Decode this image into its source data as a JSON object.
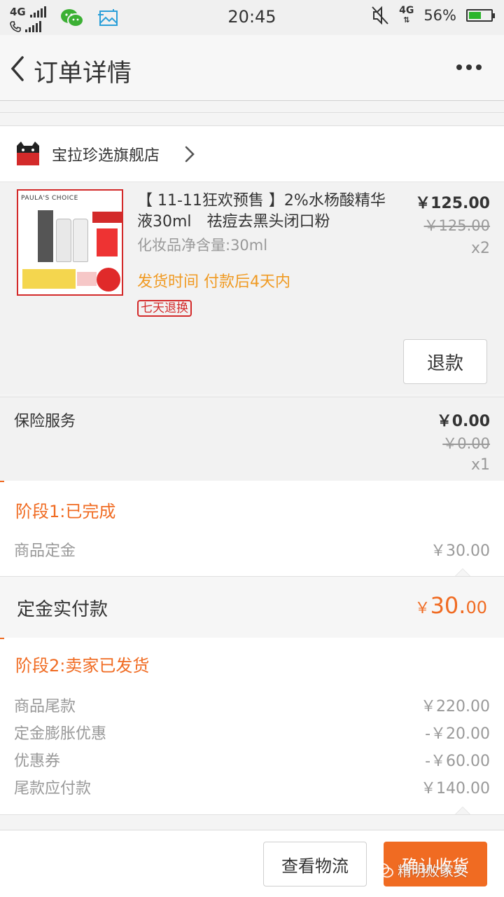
{
  "status_bar": {
    "network_top": "4G",
    "time": "20:45",
    "network_right": "4G",
    "battery_percent": "56%",
    "battery_level": 0.56,
    "battery_color": "#2bb52b"
  },
  "nav": {
    "title": "订单详情",
    "back_icon": "chevron-left-icon",
    "more_icon": "more-dots-icon"
  },
  "store": {
    "badge": "天猫",
    "name": "宝拉珍选旗舰店",
    "arrow_icon": "chevron-right-icon"
  },
  "product": {
    "title": "【 11-11狂欢预售 】2%水杨酸精华液30ml　祛痘去黑头闭口粉",
    "spec": "化妆品净含量:30ml",
    "ship_time": "发货时间 付款后4天内",
    "return_badge": "七天退换",
    "price": "￥125.00",
    "original_price": "￥125.00",
    "quantity": "x2",
    "refund_label": "退款",
    "thumbnail_brand": "PAULA'S CHOICE"
  },
  "insurance": {
    "label": "保险服务",
    "price": "￥0.00",
    "original_price": "￥0.00",
    "quantity": "x1"
  },
  "stage1": {
    "title": "阶段1:已完成",
    "rows": [
      {
        "label": "商品定金",
        "value": "￥30.00"
      }
    ],
    "deposit_label": "定金实付款",
    "deposit_currency": "￥",
    "deposit_int": "30.",
    "deposit_dec": "00"
  },
  "stage2": {
    "title": "阶段2:卖家已发货",
    "rows": [
      {
        "label": "商品尾款",
        "value": "￥220.00"
      },
      {
        "label": "定金膨胀优惠",
        "value": "-￥20.00"
      },
      {
        "label": "优惠券",
        "value": "-￥60.00"
      },
      {
        "label": "尾款应付款",
        "value": "￥140.00"
      }
    ]
  },
  "actions": {
    "logistics": "查看物流",
    "confirm": "确认收货"
  },
  "watermark": "精明败家女",
  "colors": {
    "accent": "#f06b22",
    "ship_time": "#f09a22",
    "badge_red": "#d32a2a"
  }
}
